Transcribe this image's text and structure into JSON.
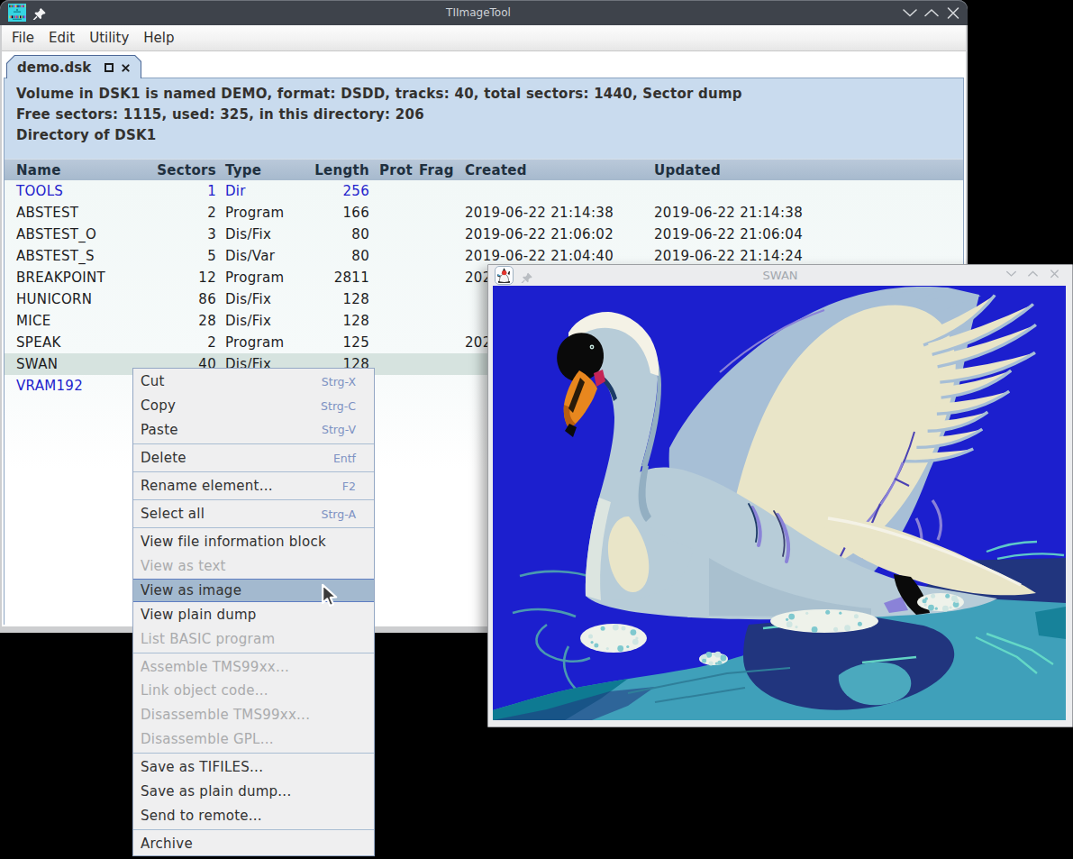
{
  "main_window": {
    "title": "TIImageTool",
    "menubar": {
      "items": [
        "File",
        "Edit",
        "Utility",
        "Help"
      ]
    },
    "tab": {
      "label": "demo.dsk"
    },
    "info_lines": [
      "Volume in DSK1 is named DEMO, format: DSDD, tracks: 40, total sectors: 1440, Sector dump",
      "Free sectors: 1115, used: 325, in this directory: 206",
      "Directory of DSK1"
    ],
    "table": {
      "columns": [
        "Name",
        "Sectors",
        "Type",
        "Length",
        "Prot",
        "Frag",
        "Created",
        "Updated"
      ],
      "rows": [
        {
          "name": "TOOLS",
          "sectors": "1",
          "type": "Dir",
          "length": "256",
          "created": "",
          "updated": "",
          "link": true,
          "selected": false
        },
        {
          "name": "ABSTEST",
          "sectors": "2",
          "type": "Program",
          "length": "166",
          "created": "2019-06-22 21:14:38",
          "updated": "2019-06-22 21:14:38",
          "link": false,
          "selected": false
        },
        {
          "name": "ABSTEST_O",
          "sectors": "3",
          "type": "Dis/Fix",
          "length": "80",
          "created": "2019-06-22 21:06:02",
          "updated": "2019-06-22 21:06:04",
          "link": false,
          "selected": false
        },
        {
          "name": "ABSTEST_S",
          "sectors": "5",
          "type": "Dis/Var",
          "length": "80",
          "created": "2019-06-22 21:04:40",
          "updated": "2019-06-22 21:14:24",
          "link": false,
          "selected": false
        },
        {
          "name": "BREAKPOINT",
          "sectors": "12",
          "type": "Program",
          "length": "2811",
          "created": "202",
          "updated": "",
          "link": false,
          "selected": false
        },
        {
          "name": "HUNICORN",
          "sectors": "86",
          "type": "Dis/Fix",
          "length": "128",
          "created": "",
          "updated": "",
          "link": false,
          "selected": false
        },
        {
          "name": "MICE",
          "sectors": "28",
          "type": "Dis/Fix",
          "length": "128",
          "created": "",
          "updated": "",
          "link": false,
          "selected": false
        },
        {
          "name": "SPEAK",
          "sectors": "2",
          "type": "Program",
          "length": "125",
          "created": "202",
          "updated": "",
          "link": false,
          "selected": false
        },
        {
          "name": "SWAN",
          "sectors": "40",
          "type": "Dis/Fix",
          "length": "128",
          "created": "",
          "updated": "",
          "link": false,
          "selected": true
        },
        {
          "name": "VRAM192",
          "sectors": "",
          "type": "",
          "length": "",
          "created": "",
          "updated": "",
          "link": true,
          "selected": false
        }
      ]
    }
  },
  "swan_window": {
    "title": "SWAN"
  },
  "colors": {
    "desktop_bg": "#000000",
    "titlebar_bg": "#3e434b",
    "titlebar_text": "#ced2d7",
    "info_panel_bg": "#c9dbee",
    "table_header_bg": "#a6b9cd",
    "link_text": "#2222cc",
    "selected_row_bg": "#d6e3df",
    "menu_bg": "#efeff0",
    "menu_highlight_bg": "#a3b9cf",
    "menu_shortcut_text": "#7d92c3",
    "swan_image_bg": "#1c1fce"
  },
  "context_menu": {
    "items": [
      {
        "label": "Cut",
        "shortcut": "Strg-X",
        "state": "normal"
      },
      {
        "label": "Copy",
        "shortcut": "Strg-C",
        "state": "normal"
      },
      {
        "label": "Paste",
        "shortcut": "Strg-V",
        "state": "normal"
      },
      {
        "sep": true
      },
      {
        "label": "Delete",
        "shortcut": "Entf",
        "state": "normal"
      },
      {
        "sep": true
      },
      {
        "label": "Rename element...",
        "shortcut": "F2",
        "state": "normal"
      },
      {
        "sep": true
      },
      {
        "label": "Select all",
        "shortcut": "Strg-A",
        "state": "normal"
      },
      {
        "sep": true
      },
      {
        "label": "View file information block",
        "shortcut": "",
        "state": "normal"
      },
      {
        "label": "View as text",
        "shortcut": "",
        "state": "disabled"
      },
      {
        "label": "View as image",
        "shortcut": "",
        "state": "highlight"
      },
      {
        "label": "View plain dump",
        "shortcut": "",
        "state": "normal"
      },
      {
        "label": "List BASIC program",
        "shortcut": "",
        "state": "disabled"
      },
      {
        "sep": true
      },
      {
        "label": "Assemble TMS99xx...",
        "shortcut": "",
        "state": "disabled"
      },
      {
        "label": "Link object code...",
        "shortcut": "",
        "state": "disabled"
      },
      {
        "label": "Disassemble TMS99xx...",
        "shortcut": "",
        "state": "disabled"
      },
      {
        "label": "Disassemble GPL...",
        "shortcut": "",
        "state": "disabled"
      },
      {
        "sep": true
      },
      {
        "label": "Save as TIFILES...",
        "shortcut": "",
        "state": "normal"
      },
      {
        "label": "Save as plain dump...",
        "shortcut": "",
        "state": "normal"
      },
      {
        "label": "Send to remote...",
        "shortcut": "",
        "state": "normal"
      },
      {
        "sep": true
      },
      {
        "label": "Archive",
        "shortcut": "",
        "state": "normal"
      }
    ]
  }
}
